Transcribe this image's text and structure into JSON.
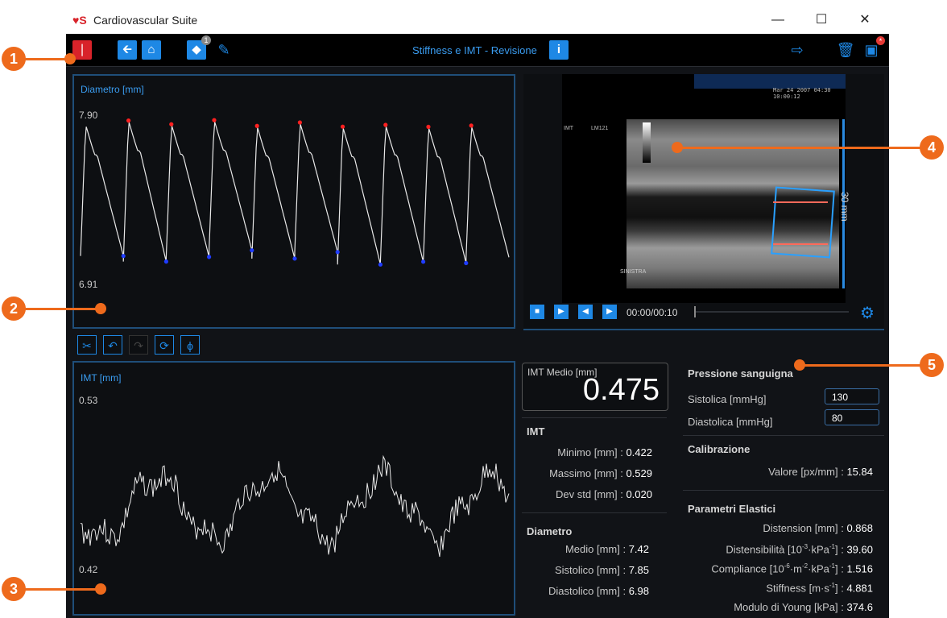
{
  "window": {
    "logo": "♥S",
    "title": "Cardiovascular Suite",
    "minimize": "—",
    "maximize": "☐",
    "close": "✕"
  },
  "toolbar": {
    "center_title": "Stiffness e IMT - Revisione",
    "badge_count": "1",
    "save_badge": "*",
    "icons": [
      "cs-logo-icon",
      "back-arrow-icon",
      "home-icon",
      "tag-icon",
      "edit-icon",
      "info-icon",
      "export-icon",
      "trash-icon",
      "save-icon"
    ]
  },
  "diameter_chart": {
    "label": "Diametro [mm]",
    "ymax": "7.90",
    "ymin": "6.91"
  },
  "video": {
    "time": "00:00/00:10",
    "scale_label": "30 mm",
    "us_header_line1": "Mar 24 2007 04:30",
    "us_header_line2": "10:00:12",
    "us_side_label": "LM121",
    "us_imt_label": "IMT",
    "us_bottom_label": "SINISTRA"
  },
  "edit_tools": [
    "scissors-icon",
    "undo-icon",
    "redo-icon",
    "refresh-icon",
    "phi-icon"
  ],
  "imt_chart": {
    "label": "IMT [mm]",
    "ymax": "0.53",
    "ymin": "0.42"
  },
  "imt_medio": {
    "label": "IMT Medio [mm]",
    "value": "0.475"
  },
  "imt_stats": {
    "title": "IMT",
    "rows": [
      {
        "label": "Minimo [mm] :",
        "value": "0.422"
      },
      {
        "label": "Massimo [mm] :",
        "value": "0.529"
      },
      {
        "label": "Dev std [mm] :",
        "value": "0.020"
      }
    ]
  },
  "diametro_stats": {
    "title": "Diametro",
    "rows": [
      {
        "label": "Medio [mm] :",
        "value": "7.42"
      },
      {
        "label": "Sistolico [mm] :",
        "value": "7.85"
      },
      {
        "label": "Diastolico [mm] :",
        "value": "6.98"
      }
    ]
  },
  "pressure": {
    "title": "Pressione sanguigna",
    "systolic_label": "Sistolica [mmHg]",
    "systolic_value": "130",
    "diastolic_label": "Diastolica [mmHg]",
    "diastolic_value": "80"
  },
  "calibration": {
    "title": "Calibrazione",
    "label": "Valore [px/mm] :",
    "value": "15.84"
  },
  "elastic": {
    "title": "Parametri Elastici",
    "distension_label": "Distension [mm] :",
    "distension_value": "0.868",
    "distensibility_label": "Distensibilità [10",
    "distensibility_value": "39.60",
    "compliance_label": "Compliance [10",
    "compliance_value": "1.516",
    "stiffness_label": "Stiffness [m·s",
    "stiffness_value": "4.881",
    "young_label": "Modulo di Young [kPa] :",
    "young_value": "374.6"
  },
  "callouts": [
    "1",
    "2",
    "3",
    "4",
    "5"
  ],
  "colors": {
    "accent": "#1e88e5",
    "callout": "#ee6a1c",
    "peak_max": "#ff2020",
    "peak_min": "#1f3cff"
  }
}
